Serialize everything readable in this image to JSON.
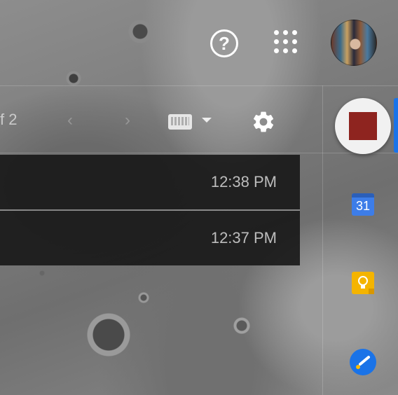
{
  "header": {
    "help_icon": "help-circle-icon",
    "apps_icon": "apps-grid-icon",
    "avatar": "user-avatar"
  },
  "toolbar": {
    "pager_text": "f 2",
    "keyboard_icon": "keyboard-icon",
    "settings_icon": "gear-icon"
  },
  "recorder": {
    "icon": "stop-record-icon",
    "color": "#8e241f"
  },
  "mail_rows": [
    {
      "time": "12:38 PM"
    },
    {
      "time": "12:37 PM"
    }
  ],
  "side_panel": {
    "calendar_label": "31",
    "keep_icon": "lightbulb-icon",
    "tasks_icon": "tasks-check-icon",
    "accent": "#1a73e8"
  }
}
